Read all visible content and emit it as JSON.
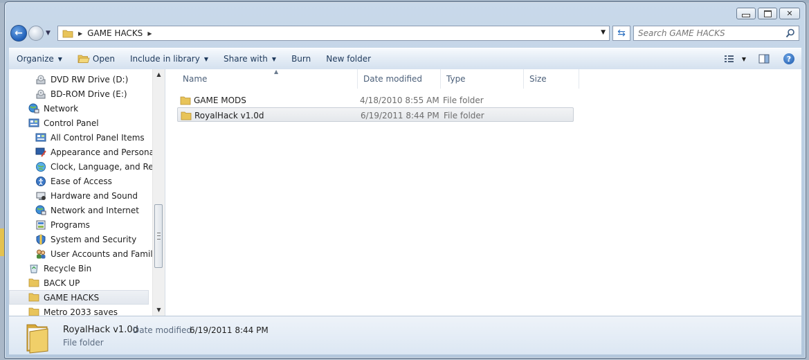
{
  "window": {
    "caption_buttons": [
      {
        "name": "minimize-button"
      },
      {
        "name": "maximize-button"
      },
      {
        "name": "close-button",
        "glyph": "✕"
      }
    ]
  },
  "address": {
    "crumbs": [
      "GAME HACKS"
    ],
    "search_placeholder": "Search GAME HACKS"
  },
  "toolbar": {
    "organize": "Organize",
    "open": "Open",
    "include_library": "Include in library",
    "share_with": "Share with",
    "burn": "Burn",
    "new_folder": "New folder"
  },
  "nav": {
    "items": [
      {
        "label": "DVD RW Drive (D:)",
        "icon": "dvd-drive-icon",
        "indent": 2,
        "selected": false
      },
      {
        "label": "BD-ROM Drive (E:)",
        "icon": "bd-drive-icon",
        "indent": 2,
        "selected": false
      },
      {
        "label": "Network",
        "icon": "network-icon",
        "indent": 1,
        "selected": false
      },
      {
        "label": "Control Panel",
        "icon": "control-panel-icon",
        "indent": 1,
        "selected": false
      },
      {
        "label": "All Control Panel Items",
        "icon": "control-panel-icon",
        "indent": 2,
        "selected": false
      },
      {
        "label": "Appearance and Personaliz",
        "icon": "appearance-icon",
        "indent": 2,
        "selected": false
      },
      {
        "label": "Clock, Language, and Regi",
        "icon": "clock-globe-icon",
        "indent": 2,
        "selected": false
      },
      {
        "label": "Ease of Access",
        "icon": "ease-of-access-icon",
        "indent": 2,
        "selected": false
      },
      {
        "label": "Hardware and Sound",
        "icon": "hardware-icon",
        "indent": 2,
        "selected": false
      },
      {
        "label": "Network and Internet",
        "icon": "network-icon",
        "indent": 2,
        "selected": false
      },
      {
        "label": "Programs",
        "icon": "programs-icon",
        "indent": 2,
        "selected": false
      },
      {
        "label": "System and Security",
        "icon": "security-icon",
        "indent": 2,
        "selected": false
      },
      {
        "label": "User Accounts and Family S",
        "icon": "user-accounts-icon",
        "indent": 2,
        "selected": false
      },
      {
        "label": "Recycle Bin",
        "icon": "recycle-bin-icon",
        "indent": 1,
        "selected": false
      },
      {
        "label": "BACK UP",
        "icon": "folder-icon",
        "indent": 1,
        "selected": false
      },
      {
        "label": "GAME HACKS",
        "icon": "folder-icon",
        "indent": 1,
        "selected": true
      },
      {
        "label": "Metro 2033 saves",
        "icon": "folder-icon",
        "indent": 1,
        "selected": false
      }
    ]
  },
  "columns": {
    "name": "Name",
    "date": "Date modified",
    "type": "Type",
    "size": "Size"
  },
  "files": [
    {
      "name": "GAME MODS",
      "date": "4/18/2010 8:55 AM",
      "type": "File folder",
      "selected": false
    },
    {
      "name": "RoyalHack v1.0d",
      "date": "6/19/2011 8:44 PM",
      "type": "File folder",
      "selected": true
    }
  ],
  "details": {
    "name": "RoyalHack v1.0d",
    "date_label": "Date modified:",
    "date_value": "6/19/2011 8:44 PM",
    "type": "File folder"
  },
  "colors": {
    "folder": "#e8c45a",
    "accent": "#1f5fb8"
  }
}
